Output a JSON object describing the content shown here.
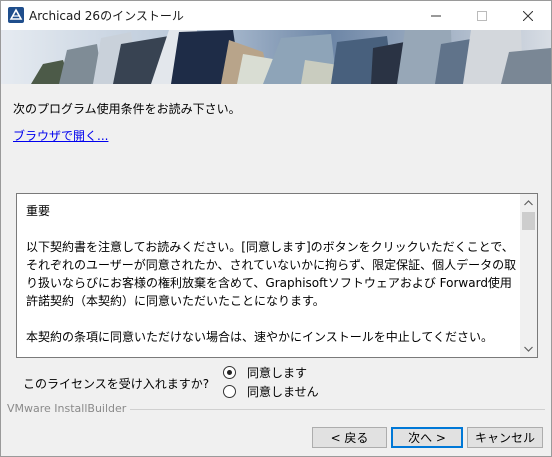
{
  "window": {
    "title": "Archicad 26のインストール"
  },
  "intro_text": "次のプログラム使用条件をお読み下さい。",
  "browser_link": "ブラウザで開く...",
  "license": {
    "heading": "重要",
    "paragraph1": "以下契約書を注意してお読みください。[同意します]のボタンをクリックいただくことで、それぞれのユーザーが同意されたか、されていないかに拘らず、限定保証、個人データの取り扱いならびにお客様の権利放棄を含めて、Graphisoftソフトウェアおよび Forward使用許諾契約（本契約）に同意いただいたことになります。",
    "paragraph2": "本契約の条項に同意いただけない場合は、速やかにインストールを中止してください。"
  },
  "question": "このライセンスを受け入れますか?",
  "options": [
    {
      "label": "同意します",
      "selected": true
    },
    {
      "label": "同意しません",
      "selected": false
    }
  ],
  "footer_brand": "VMware InstallBuilder",
  "buttons": {
    "back": "< 戻る",
    "next": "次へ >",
    "cancel": "キャンセル"
  },
  "colors": {
    "link": "#0000ee",
    "focus_border": "#0078d7",
    "dialog_bg": "#f0f0f0"
  }
}
